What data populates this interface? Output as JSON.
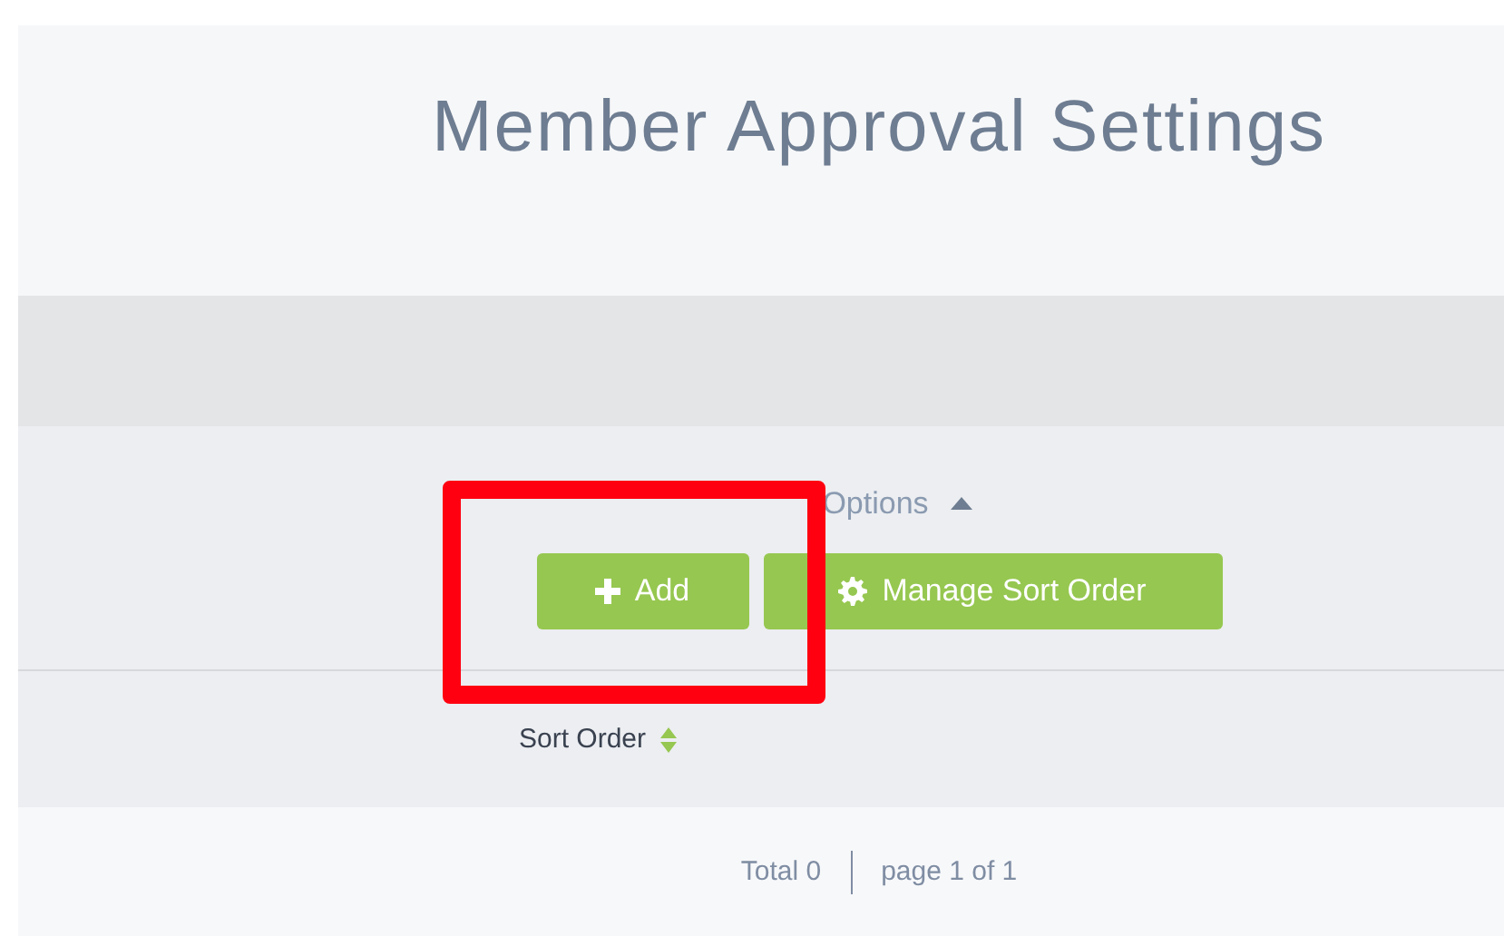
{
  "title": "Member Approval Settings",
  "options": {
    "label": "Options",
    "expanded": true
  },
  "buttons": [
    {
      "label": "Add",
      "kind": "add"
    },
    {
      "label": "Manage Sort Order",
      "kind": "sort"
    }
  ],
  "table": {
    "columns": [
      {
        "label": "Sort Order",
        "sortable": true
      }
    ]
  },
  "footer": {
    "total": "Total 0",
    "page": "page 1 of 1"
  },
  "highlight": true
}
